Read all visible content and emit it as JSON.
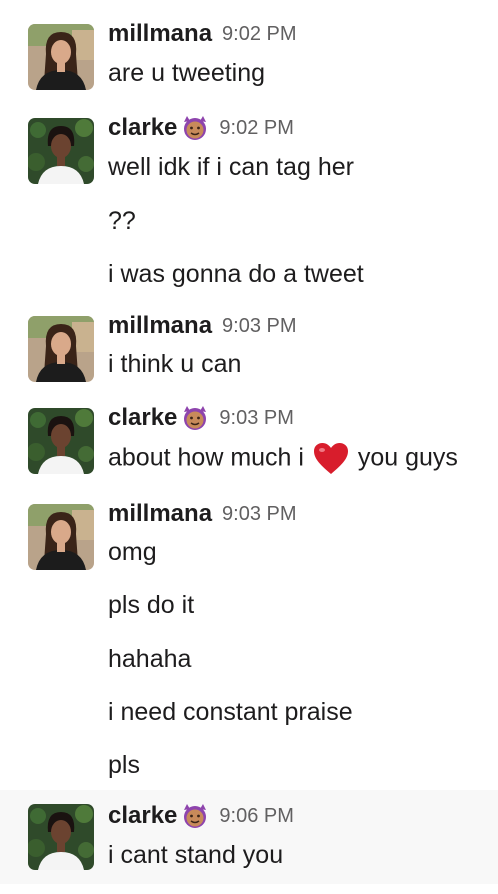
{
  "messages": [
    {
      "user": "millmana",
      "time": "9:02 PM",
      "lines": [
        "are u tweeting"
      ]
    },
    {
      "user": "clarke",
      "time": "9:02 PM",
      "lines": [
        "well idk if i can tag her",
        "??",
        "i was gonna do a tweet"
      ]
    },
    {
      "user": "millmana",
      "time": "9:03 PM",
      "lines": [
        "i think u can"
      ]
    },
    {
      "user": "clarke",
      "time": "9:03 PM",
      "lines": [
        {
          "before": "about how much i",
          "emoji": "heart-emoji",
          "after": "you guys"
        }
      ]
    },
    {
      "user": "millmana",
      "time": "9:03 PM",
      "lines": [
        "omg",
        "pls do it",
        "hahaha",
        "i need constant praise",
        "pls"
      ]
    },
    {
      "user": "clarke",
      "time": "9:06 PM",
      "lines": [
        "i cant stand you"
      ]
    }
  ],
  "status_emoji": "smiling-imp-emoji",
  "colors": {
    "text": "#1d1c1d",
    "timestamp": "#616061",
    "highlight": "#f8f8f8",
    "heart": "#d81d2c",
    "imp": "#8e44ad"
  }
}
